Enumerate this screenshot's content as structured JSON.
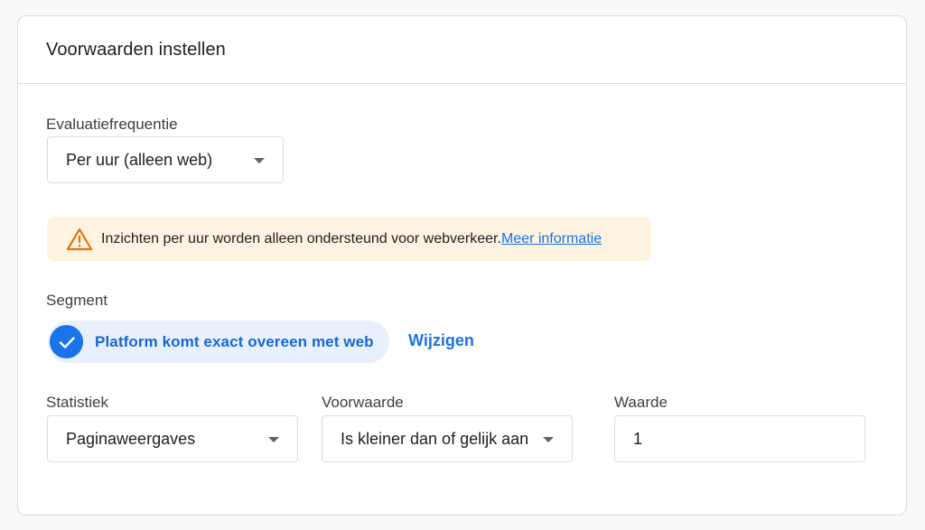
{
  "header": {
    "title": "Voorwaarden instellen"
  },
  "frequency": {
    "label": "Evaluatiefrequentie",
    "value": "Per uur (alleen web)",
    "icon": "caret-down-icon"
  },
  "alert": {
    "icon": "warning-triangle-icon",
    "color": "#e37400",
    "background": "#fef3e0",
    "text": "Inzichten per uur worden alleen ondersteund voor webverkeer.",
    "link": "Meer informatie"
  },
  "segment": {
    "label": "Segment",
    "chip": "Platform komt exact overeen met web",
    "chip_icon": "check-circle-icon",
    "change": "Wijzigen"
  },
  "metric": {
    "label": "Statistiek",
    "value": "Paginaweergaves"
  },
  "condition": {
    "label": "Voorwaarde",
    "value": "Is kleiner dan of gelijk aan"
  },
  "threshold": {
    "label": "Waarde",
    "value": "1"
  },
  "colors": {
    "accent": "#1a73e8",
    "chip_bg": "#e8f0fe",
    "border": "#dadce0"
  }
}
